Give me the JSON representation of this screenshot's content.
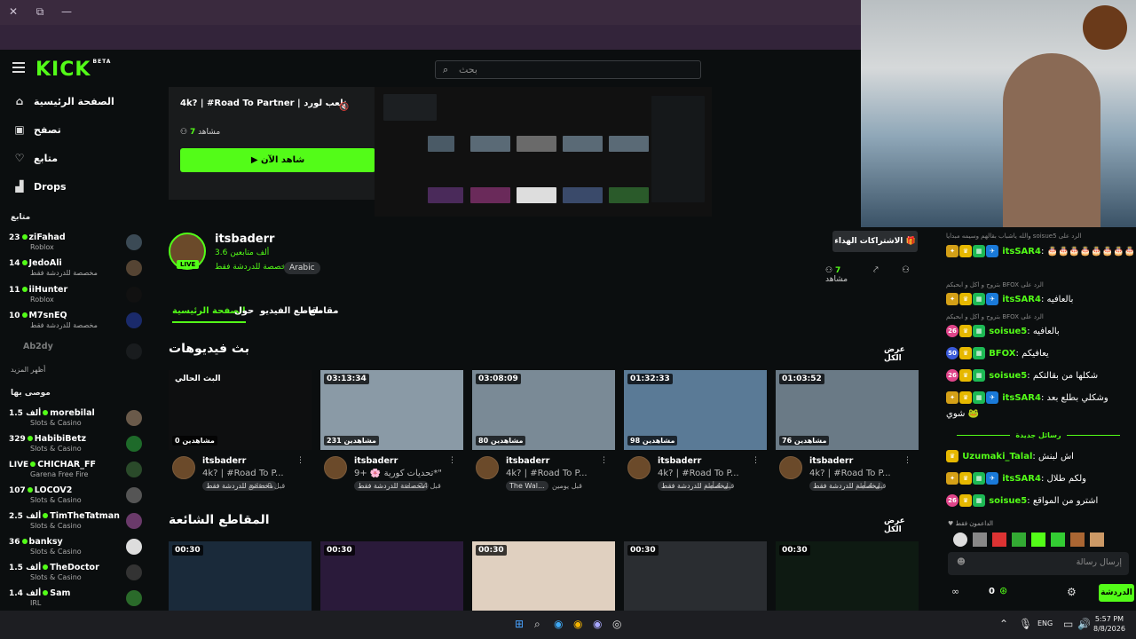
{
  "browser": {
    "minimize": "—",
    "restore": "⧉",
    "close": "✕"
  },
  "header": {
    "logo": "KICK",
    "logo_beta": "BETA",
    "search_placeholder": "بحث"
  },
  "sidebar": {
    "nav": [
      {
        "label": "الصفحة الرئيسية",
        "icon": "home-icon"
      },
      {
        "label": "تصفح",
        "icon": "browse-icon"
      },
      {
        "label": "متابع",
        "icon": "heart-icon"
      },
      {
        "label": "Drops",
        "icon": "drops-icon"
      }
    ],
    "following_title": "متابع",
    "following": [
      {
        "viewers": "23",
        "name": "ziFahad",
        "category": "Roblox"
      },
      {
        "viewers": "14",
        "name": "JedoAli",
        "category": "مخصصة للدردشة فقط"
      },
      {
        "viewers": "11",
        "name": "iiHunter",
        "category": "Roblox"
      },
      {
        "viewers": "10",
        "name": "M7snEQ",
        "category": "مخصصة للدردشة فقط"
      },
      {
        "viewers": "",
        "name": "Ab2dy",
        "category": ""
      }
    ],
    "show_more": "أظهر المزيد",
    "recommended_title": "موصى بها",
    "recommended": [
      {
        "viewers": "1.5 ألف",
        "name": "morebilal",
        "category": "Slots & Casino"
      },
      {
        "viewers": "329",
        "name": "HabibiBetz",
        "category": "Slots & Casino"
      },
      {
        "viewers": "LIVE",
        "name": "CHICHAR_FF",
        "category": "Garena Free Fire"
      },
      {
        "viewers": "107",
        "name": "LOCOV2",
        "category": "Slots & Casino"
      },
      {
        "viewers": "2.5 ألف",
        "name": "TimTheTatman",
        "category": "Slots & Casino"
      },
      {
        "viewers": "36",
        "name": "banksy",
        "category": "Slots & Casino"
      },
      {
        "viewers": "1.5 ألف",
        "name": "TheDoctor",
        "category": "Slots & Casino"
      },
      {
        "viewers": "1.4 ألف",
        "name": "Sam",
        "category": "IRL"
      }
    ]
  },
  "preview": {
    "title": "4k? | #Road To Partner | تلعب لورد",
    "viewers_count": "7",
    "viewers_label": "مشاهد",
    "watch_now": "▶ شاهد الآن"
  },
  "profile": {
    "name": "itsbaderr",
    "live": "LIVE",
    "followers": "3.6 ألف متابعين",
    "category": "مخصصة للدردشة فقط",
    "language": "Arabic",
    "gift_subs": "الاشتراكات الهداء",
    "watching_count": "7",
    "watching_label": "مشاهد"
  },
  "tabs": [
    "الصفحة الرئيسية",
    "حول",
    "مقاطع الفيديو",
    "مقاطع"
  ],
  "videos_section": {
    "title": "بث فيديوهات",
    "show_all": "عرض الكل"
  },
  "videos": [
    {
      "duration": "البث الحالي",
      "views": "0 مشاهدين",
      "user": "itsbaderr",
      "title": "4k? | #Road To P...",
      "tag": "مخصصة للدردشة فقط",
      "time": "قبل 9 دقائق"
    },
    {
      "duration": "03:13:34",
      "views": "231 مشاهدين",
      "user": "itsbaderr",
      "title": "تحديات كورية 🌸 +9*\"",
      "tag": "مخصصة للدردشة فقط",
      "time": "قبل 24 ساعة"
    },
    {
      "duration": "03:08:09",
      "views": "80 مشاهدين",
      "user": "itsbaderr",
      "title": "4k? | #Road To P...",
      "tag": "The Wal...",
      "time": "قبل يومين"
    },
    {
      "duration": "01:32:33",
      "views": "98 مشاهدين",
      "user": "itsbaderr",
      "title": "4k? | #Road To P...",
      "tag": "مخصصة للدردشة فقط",
      "time": "قبل 4 أيام"
    },
    {
      "duration": "01:03:52",
      "views": "76 مشاهدين",
      "user": "itsbaderr",
      "title": "4k? | #Road To P...",
      "tag": "مخصصة للدردشة فقط",
      "time": "قبل 4 أيام"
    }
  ],
  "clips_section": {
    "title": "المقاطع الشائعة",
    "show_all": "عرض الكل"
  },
  "clips": [
    {
      "duration": "00:30"
    },
    {
      "duration": "00:30"
    },
    {
      "duration": "00:30"
    },
    {
      "duration": "00:30"
    },
    {
      "duration": "00:30"
    }
  ],
  "chat": {
    "replies": [
      "والله ياشباب بقالهم وسيمه مبدايا soisue5 الرد على",
      "بتروح و اكل و ابحبكم BFOX الرد على",
      "بتروح و اكل و ابحبكم BFOX الرد على"
    ],
    "messages": [
      {
        "user": "itsSAR4",
        "text": "🎂🎂🎂🎂🎂🎂🎂🎂🎂🎂🎂🎂🎂",
        "color": "#53fc18"
      },
      {
        "user": "itsSAR4",
        "text": "بالعافيه",
        "color": "#53fc18"
      },
      {
        "user": "soisue5",
        "text": "بالعافيه",
        "color": "#53fc18"
      },
      {
        "user": "BFOX",
        "text": "يعافيكم",
        "color": "#53fc18"
      },
      {
        "user": "soisue5",
        "text": "شكلها من بقالتكم",
        "color": "#53fc18"
      },
      {
        "user": "itsSAR4",
        "text": "وشكلي بطلع بعد",
        "color": "#53fc18"
      },
      {
        "user": "",
        "text": "شوي 🐸",
        "color": "#ffffff"
      },
      {
        "user": "Uzumaki_Talal",
        "text": "اش لبنش",
        "color": "#53fc18"
      },
      {
        "user": "itsSAR4",
        "text": "ولكم طلال",
        "color": "#53fc18"
      },
      {
        "user": "soisue5",
        "text": "اشترو من المواقع",
        "color": "#53fc18"
      }
    ],
    "new_messages": "رسائل جديدة",
    "supporters": "الداعمون فقط",
    "input_placeholder": "إرسال رسالة",
    "send": "الدردشة",
    "points": "0"
  },
  "taskbar": {
    "lang": "ENG",
    "time": "5:57 PM",
    "date": "8/8/2026"
  }
}
